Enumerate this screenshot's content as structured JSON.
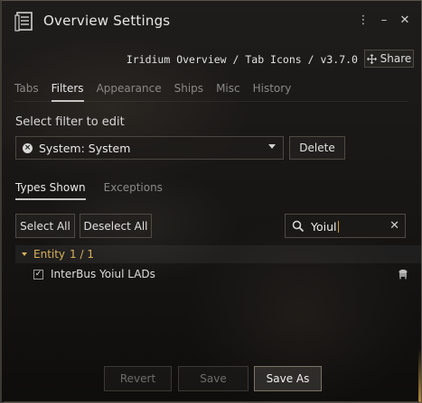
{
  "window": {
    "title": "Overview Settings",
    "profile_path": "Iridium Overview / Tab Icons / v3.7.0",
    "share_label": "Share",
    "header_icons": [
      "more-options-icon",
      "minimize-icon",
      "close-icon"
    ]
  },
  "tabs": [
    {
      "label": "Tabs",
      "active": false
    },
    {
      "label": "Filters",
      "active": true
    },
    {
      "label": "Appearance",
      "active": false
    },
    {
      "label": "Ships",
      "active": false
    },
    {
      "label": "Misc",
      "active": false
    },
    {
      "label": "History",
      "active": false
    }
  ],
  "filter": {
    "section_label": "Select filter to edit",
    "selected": "System: System",
    "delete_label": "Delete"
  },
  "subtabs": [
    {
      "label": "Types Shown",
      "active": true
    },
    {
      "label": "Exceptions",
      "active": false
    }
  ],
  "toolbar": {
    "select_all": "Select All",
    "deselect_all": "Deselect All",
    "search_value": "Yoiul"
  },
  "list": {
    "group_label": "Entity",
    "group_count": "1 / 1",
    "items": [
      {
        "label": "InterBus Yoiul LADs",
        "checked": true
      }
    ]
  },
  "footer": {
    "revert_label": "Revert",
    "save_label": "Save",
    "save_as_label": "Save As"
  },
  "colors": {
    "accent_gold": "#d9b25a",
    "text": "#e0e0e0"
  }
}
